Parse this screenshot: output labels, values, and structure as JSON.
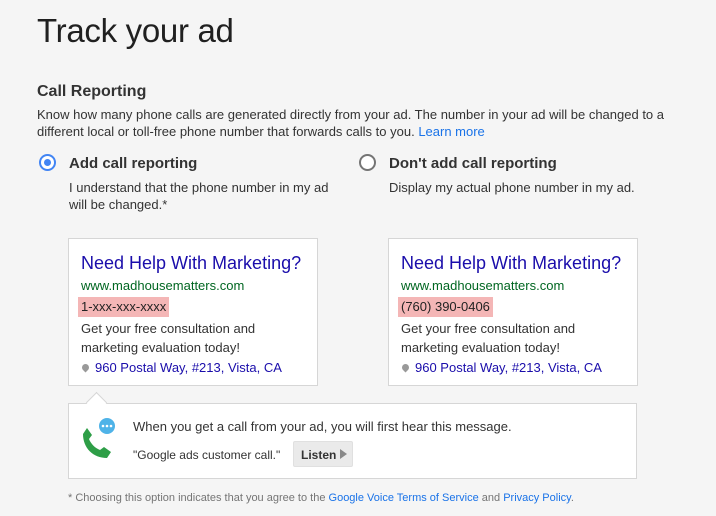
{
  "page_title": "Track your ad",
  "section_title": "Call Reporting",
  "description": "Know how many phone calls are generated directly from your ad. The number in your ad will be changed to a different local or toll-free phone number that forwards calls to you.",
  "learn_more": "Learn more",
  "options": [
    {
      "label": "Add call reporting",
      "description": "I understand that the phone number in my ad will be changed.*",
      "selected": true
    },
    {
      "label": "Don't add call reporting",
      "description": "Display my actual phone number in my ad.",
      "selected": false
    }
  ],
  "ads": [
    {
      "headline": "Need Help With Marketing?",
      "url": "www.madhousematters.com",
      "phone": "1-xxx-xxx-xxxx",
      "text": "Get your free consultation and marketing evaluation today!",
      "location": "960 Postal Way, #213, Vista, CA"
    },
    {
      "headline": "Need Help With Marketing?",
      "url": "www.madhousematters.com",
      "phone": "(760) 390-0406",
      "text": "Get your free consultation and marketing evaluation today!",
      "location": "960 Postal Way, #213, Vista, CA"
    }
  ],
  "message": {
    "text": "When you get a call from your ad, you will first hear this message.",
    "quote": "\"Google ads customer call.\"",
    "listen_label": "Listen",
    "icon": "google-voice-icon"
  },
  "footnote": {
    "prefix": "* Choosing this option indicates that you agree to the ",
    "link1": "Google Voice Terms of Service",
    "middle": " and ",
    "link2": "Privacy Policy",
    "suffix": "."
  },
  "colors": {
    "accent": "#4285f4",
    "headline": "#1a0dab",
    "url": "#006621",
    "phone_highlight": "#f4b6b6",
    "link": "#1a73e8"
  }
}
